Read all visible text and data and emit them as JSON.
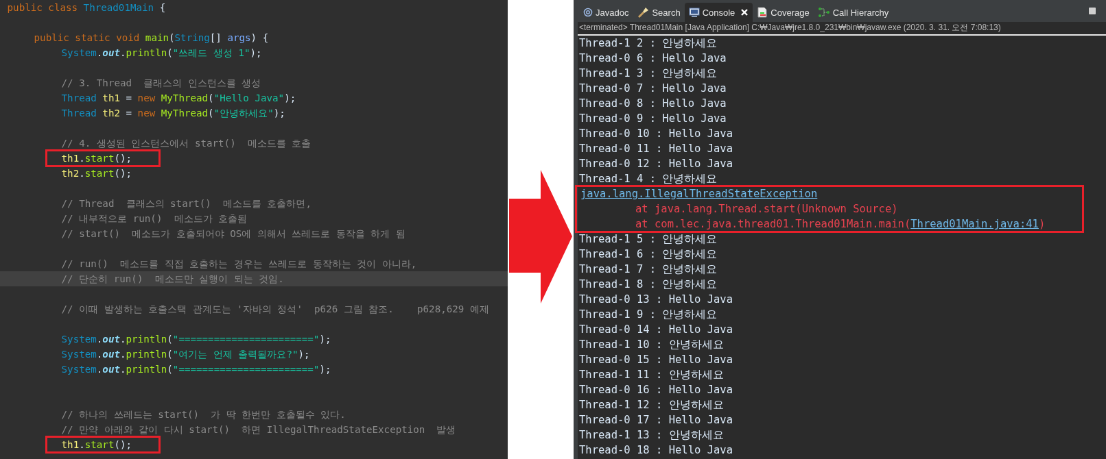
{
  "editor": {
    "lines": [
      {
        "kind": "class",
        "boxed": false,
        "current": false,
        "tokens": [
          {
            "text": "public class ",
            "kind": "keyword"
          },
          {
            "text": "Thread01Main",
            "kind": "type"
          },
          {
            "text": " {",
            "kind": "plain"
          }
        ]
      },
      {
        "kind": "blank"
      },
      {
        "kind": "method",
        "boxed": false,
        "current": false,
        "tokens": [
          {
            "text": "public static void ",
            "kind": "keyword"
          },
          {
            "text": "main",
            "kind": "method"
          },
          {
            "text": "(",
            "kind": "plain"
          },
          {
            "text": "String",
            "kind": "type"
          },
          {
            "text": "[] ",
            "kind": "plain"
          },
          {
            "text": "args",
            "kind": "param"
          },
          {
            "text": ") {",
            "kind": "plain"
          }
        ]
      },
      {
        "kind": "statement",
        "boxed": false,
        "current": false,
        "tokens": [
          {
            "text": "System",
            "kind": "type"
          },
          {
            "text": ".",
            "kind": "plain"
          },
          {
            "text": "out",
            "kind": "field"
          },
          {
            "text": ".",
            "kind": "plain"
          },
          {
            "text": "println",
            "kind": "method"
          },
          {
            "text": "(",
            "kind": "plain"
          },
          {
            "text": "\"쓰레드 생성 1\"",
            "kind": "string"
          },
          {
            "text": ");",
            "kind": "plain"
          }
        ]
      },
      {
        "kind": "blank"
      },
      {
        "kind": "statement",
        "boxed": false,
        "current": false,
        "tokens": [
          {
            "text": "// 3. Thread  클래스의 인스턴스를 생성",
            "kind": "comment"
          }
        ]
      },
      {
        "kind": "statement",
        "boxed": false,
        "current": false,
        "tokens": [
          {
            "text": "Thread ",
            "kind": "type"
          },
          {
            "text": "th1",
            "kind": "var"
          },
          {
            "text": " = ",
            "kind": "plain"
          },
          {
            "text": "new ",
            "kind": "keyword"
          },
          {
            "text": "MyThread",
            "kind": "method"
          },
          {
            "text": "(",
            "kind": "plain"
          },
          {
            "text": "\"Hello Java\"",
            "kind": "string"
          },
          {
            "text": ");",
            "kind": "plain"
          }
        ]
      },
      {
        "kind": "statement",
        "boxed": false,
        "current": false,
        "tokens": [
          {
            "text": "Thread ",
            "kind": "type"
          },
          {
            "text": "th2",
            "kind": "var"
          },
          {
            "text": " = ",
            "kind": "plain"
          },
          {
            "text": "new ",
            "kind": "keyword"
          },
          {
            "text": "MyThread",
            "kind": "method"
          },
          {
            "text": "(",
            "kind": "plain"
          },
          {
            "text": "\"안녕하세요\"",
            "kind": "string"
          },
          {
            "text": ");",
            "kind": "plain"
          }
        ]
      },
      {
        "kind": "blank"
      },
      {
        "kind": "statement",
        "boxed": false,
        "current": false,
        "tokens": [
          {
            "text": "// 4. 생성된 인스턴스에서 start()  메소드를 호출",
            "kind": "comment"
          }
        ]
      },
      {
        "kind": "statement",
        "boxed": true,
        "current": false,
        "tokens": [
          {
            "text": "th1",
            "kind": "var"
          },
          {
            "text": ".",
            "kind": "plain"
          },
          {
            "text": "start",
            "kind": "method"
          },
          {
            "text": "();",
            "kind": "plain"
          }
        ]
      },
      {
        "kind": "statement",
        "boxed": false,
        "current": false,
        "tokens": [
          {
            "text": "th2",
            "kind": "var"
          },
          {
            "text": ".",
            "kind": "plain"
          },
          {
            "text": "start",
            "kind": "method"
          },
          {
            "text": "();",
            "kind": "plain"
          }
        ]
      },
      {
        "kind": "blank"
      },
      {
        "kind": "statement",
        "boxed": false,
        "current": false,
        "tokens": [
          {
            "text": "// Thread  클래스의 start()  메소드를 호출하면,",
            "kind": "comment"
          }
        ]
      },
      {
        "kind": "statement",
        "boxed": false,
        "current": false,
        "tokens": [
          {
            "text": "// 내부적으로 run()  메소드가 호출됨",
            "kind": "comment"
          }
        ]
      },
      {
        "kind": "statement",
        "boxed": false,
        "current": false,
        "tokens": [
          {
            "text": "// start()  메소드가 호출되어야 OS에 의해서 쓰레드로 동작을 하게 됨",
            "kind": "comment"
          }
        ]
      },
      {
        "kind": "blank"
      },
      {
        "kind": "statement",
        "boxed": false,
        "current": false,
        "tokens": [
          {
            "text": "// run()  메소드를 직접 호출하는 경우는 쓰레드로 동작하는 것이 아니라,",
            "kind": "comment"
          }
        ]
      },
      {
        "kind": "statement",
        "boxed": false,
        "current": true,
        "tokens": [
          {
            "text": "// 단순히 run()  메소드만 실행이 되는 것임.",
            "kind": "comment"
          }
        ]
      },
      {
        "kind": "blank"
      },
      {
        "kind": "statement",
        "boxed": false,
        "current": false,
        "tokens": [
          {
            "text": "// 이때 발생하는 호출스택 관계도는 '자바의 정석'  p626 그림 참조.    p628,629 예제",
            "kind": "comment"
          }
        ]
      },
      {
        "kind": "blank"
      },
      {
        "kind": "statement",
        "boxed": false,
        "current": false,
        "tokens": [
          {
            "text": "System",
            "kind": "type"
          },
          {
            "text": ".",
            "kind": "plain"
          },
          {
            "text": "out",
            "kind": "field"
          },
          {
            "text": ".",
            "kind": "plain"
          },
          {
            "text": "println",
            "kind": "method"
          },
          {
            "text": "(",
            "kind": "plain"
          },
          {
            "text": "\"=======================\"",
            "kind": "string"
          },
          {
            "text": ");",
            "kind": "plain"
          }
        ]
      },
      {
        "kind": "statement",
        "boxed": false,
        "current": false,
        "tokens": [
          {
            "text": "System",
            "kind": "type"
          },
          {
            "text": ".",
            "kind": "plain"
          },
          {
            "text": "out",
            "kind": "field"
          },
          {
            "text": ".",
            "kind": "plain"
          },
          {
            "text": "println",
            "kind": "method"
          },
          {
            "text": "(",
            "kind": "plain"
          },
          {
            "text": "\"여기는 언제 출력될까요?\"",
            "kind": "string"
          },
          {
            "text": ");",
            "kind": "plain"
          }
        ]
      },
      {
        "kind": "statement",
        "boxed": false,
        "current": false,
        "tokens": [
          {
            "text": "System",
            "kind": "type"
          },
          {
            "text": ".",
            "kind": "plain"
          },
          {
            "text": "out",
            "kind": "field"
          },
          {
            "text": ".",
            "kind": "plain"
          },
          {
            "text": "println",
            "kind": "method"
          },
          {
            "text": "(",
            "kind": "plain"
          },
          {
            "text": "\"=======================\"",
            "kind": "string"
          },
          {
            "text": ");",
            "kind": "plain"
          }
        ]
      },
      {
        "kind": "blank"
      },
      {
        "kind": "blank"
      },
      {
        "kind": "statement",
        "boxed": false,
        "current": false,
        "tokens": [
          {
            "text": "// 하나의 쓰레드는 start()  가 딱 한번만 호출될수 있다.",
            "kind": "comment"
          }
        ]
      },
      {
        "kind": "statement",
        "boxed": false,
        "current": false,
        "tokens": [
          {
            "text": "// 만약 아래와 같이 다시 start()  하면 IllegalThreadStateException  발생",
            "kind": "comment"
          }
        ]
      },
      {
        "kind": "statement",
        "boxed": true,
        "current": false,
        "tokens": [
          {
            "text": "th1",
            "kind": "var"
          },
          {
            "text": ".",
            "kind": "plain"
          },
          {
            "text": "start",
            "kind": "method"
          },
          {
            "text": "();",
            "kind": "plain"
          }
        ]
      }
    ]
  },
  "tabs": [
    {
      "label": "Javadoc",
      "selected": false,
      "closable": false
    },
    {
      "label": "Search",
      "selected": false,
      "closable": false
    },
    {
      "label": "Console",
      "selected": true,
      "closable": true
    },
    {
      "label": "Coverage",
      "selected": false,
      "closable": false
    },
    {
      "label": "Call Hierarchy",
      "selected": false,
      "closable": false
    }
  ],
  "console": {
    "status": "<terminated> Thread01Main [Java Application] C:₩Java₩jre1.8.0_231₩bin₩javaw.exe (2020. 3. 31. 오전 7:08:13)",
    "lines": [
      {
        "kind": "output",
        "boxed": false,
        "tokens": [
          {
            "text": "Thread-1 2 : 안녕하세요",
            "kind": "plain"
          }
        ]
      },
      {
        "kind": "output",
        "boxed": false,
        "tokens": [
          {
            "text": "Thread-0 6 : Hello Java",
            "kind": "plain"
          }
        ]
      },
      {
        "kind": "output",
        "boxed": false,
        "tokens": [
          {
            "text": "Thread-1 3 : 안녕하세요",
            "kind": "plain"
          }
        ]
      },
      {
        "kind": "output",
        "boxed": false,
        "tokens": [
          {
            "text": "Thread-0 7 : Hello Java",
            "kind": "plain"
          }
        ]
      },
      {
        "kind": "output",
        "boxed": false,
        "tokens": [
          {
            "text": "Thread-0 8 : Hello Java",
            "kind": "plain"
          }
        ]
      },
      {
        "kind": "output",
        "boxed": false,
        "tokens": [
          {
            "text": "Thread-0 9 : Hello Java",
            "kind": "plain"
          }
        ]
      },
      {
        "kind": "output",
        "boxed": false,
        "tokens": [
          {
            "text": "Thread-0 10 : Hello Java",
            "kind": "plain"
          }
        ]
      },
      {
        "kind": "output",
        "boxed": false,
        "tokens": [
          {
            "text": "Thread-0 11 : Hello Java",
            "kind": "plain"
          }
        ]
      },
      {
        "kind": "output",
        "boxed": false,
        "tokens": [
          {
            "text": "Thread-0 12 : Hello Java",
            "kind": "plain"
          }
        ]
      },
      {
        "kind": "output",
        "boxed": false,
        "tokens": [
          {
            "text": "Thread-1 4 : 안녕하세요",
            "kind": "plain"
          }
        ]
      },
      {
        "kind": "output",
        "boxed": true,
        "tokens": [
          {
            "text": "java.lang.IllegalThreadStateException",
            "kind": "link"
          }
        ]
      },
      {
        "kind": "trace",
        "boxed": true,
        "tokens": [
          {
            "text": "at java.lang.Thread.start(Unknown Source)",
            "kind": "error"
          }
        ]
      },
      {
        "kind": "trace",
        "boxed": true,
        "tokens": [
          {
            "text": "at com.lec.java.thread01.Thread01Main.main(",
            "kind": "error"
          },
          {
            "text": "Thread01Main.java:41",
            "kind": "link"
          },
          {
            "text": ")",
            "kind": "error"
          }
        ]
      },
      {
        "kind": "output",
        "boxed": false,
        "tokens": [
          {
            "text": "Thread-1 5 : 안녕하세요",
            "kind": "plain"
          }
        ]
      },
      {
        "kind": "output",
        "boxed": false,
        "tokens": [
          {
            "text": "Thread-1 6 : 안녕하세요",
            "kind": "plain"
          }
        ]
      },
      {
        "kind": "output",
        "boxed": false,
        "tokens": [
          {
            "text": "Thread-1 7 : 안녕하세요",
            "kind": "plain"
          }
        ]
      },
      {
        "kind": "output",
        "boxed": false,
        "tokens": [
          {
            "text": "Thread-1 8 : 안녕하세요",
            "kind": "plain"
          }
        ]
      },
      {
        "kind": "output",
        "boxed": false,
        "tokens": [
          {
            "text": "Thread-0 13 : Hello Java",
            "kind": "plain"
          }
        ]
      },
      {
        "kind": "output",
        "boxed": false,
        "tokens": [
          {
            "text": "Thread-1 9 : 안녕하세요",
            "kind": "plain"
          }
        ]
      },
      {
        "kind": "output",
        "boxed": false,
        "tokens": [
          {
            "text": "Thread-0 14 : Hello Java",
            "kind": "plain"
          }
        ]
      },
      {
        "kind": "output",
        "boxed": false,
        "tokens": [
          {
            "text": "Thread-1 10 : 안녕하세요",
            "kind": "plain"
          }
        ]
      },
      {
        "kind": "output",
        "boxed": false,
        "tokens": [
          {
            "text": "Thread-0 15 : Hello Java",
            "kind": "plain"
          }
        ]
      },
      {
        "kind": "output",
        "boxed": false,
        "tokens": [
          {
            "text": "Thread-1 11 : 안녕하세요",
            "kind": "plain"
          }
        ]
      },
      {
        "kind": "output",
        "boxed": false,
        "tokens": [
          {
            "text": "Thread-0 16 : Hello Java",
            "kind": "plain"
          }
        ]
      },
      {
        "kind": "output",
        "boxed": false,
        "tokens": [
          {
            "text": "Thread-1 12 : 안녕하세요",
            "kind": "plain"
          }
        ]
      },
      {
        "kind": "output",
        "boxed": false,
        "tokens": [
          {
            "text": "Thread-0 17 : Hello Java",
            "kind": "plain"
          }
        ]
      },
      {
        "kind": "output",
        "boxed": false,
        "tokens": [
          {
            "text": "Thread-1 13 : 안녕하세요",
            "kind": "plain"
          }
        ]
      },
      {
        "kind": "output",
        "boxed": false,
        "tokens": [
          {
            "text": "Thread-0 18 : Hello Java",
            "kind": "plain"
          }
        ]
      }
    ]
  }
}
